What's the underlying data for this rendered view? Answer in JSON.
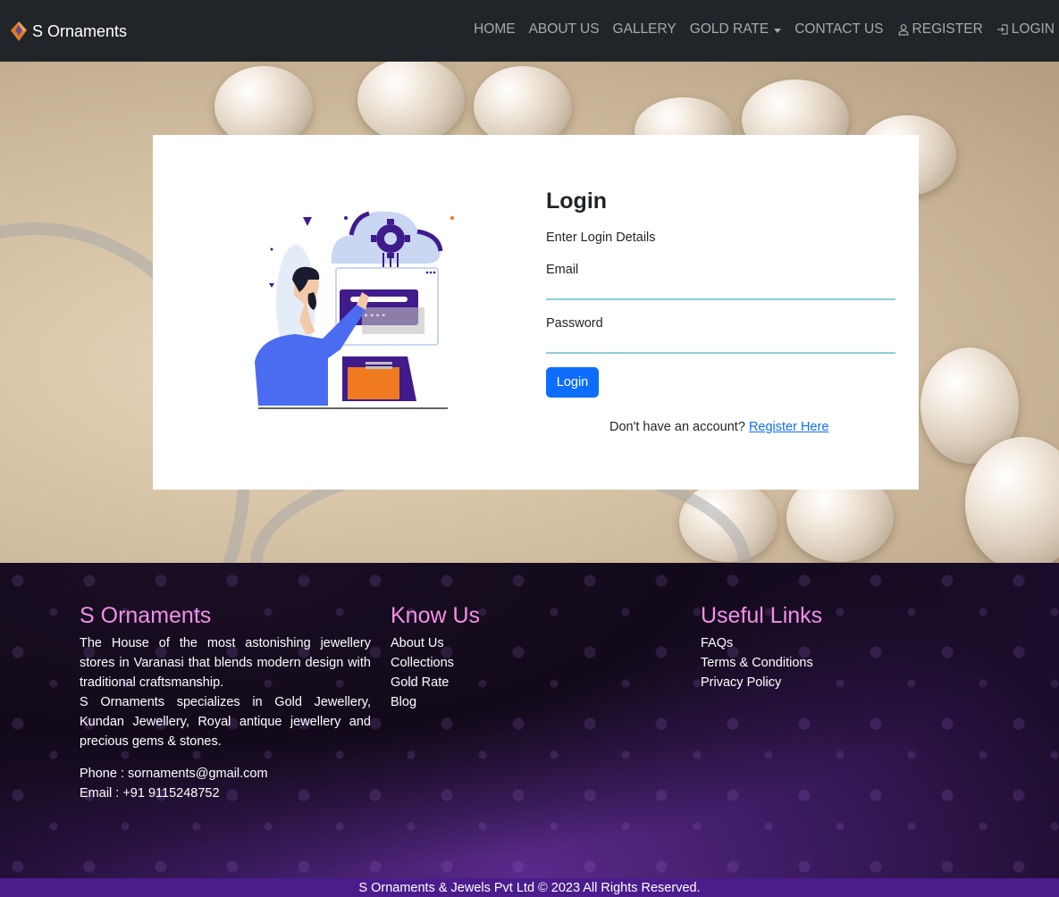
{
  "brand": {
    "name": "S Ornaments",
    "logo_icon": "diamond-logo-icon"
  },
  "nav": {
    "home": "HOME",
    "about": "ABOUT US",
    "gallery": "GALLERY",
    "gold_rate": "GOLD RATE",
    "contact": "CONTACT US",
    "register": "REGISTER",
    "login": "LOGIN"
  },
  "login": {
    "title": "Login",
    "subtitle": "Enter Login Details",
    "email_label": "Email",
    "email_value": "",
    "password_label": "Password",
    "password_value": "",
    "button": "Login",
    "no_account": "Don't have an account?",
    "register_link": "Register Here"
  },
  "footer": {
    "col1": {
      "title": "S Ornaments",
      "about1": "The House of the most astonishing jewellery stores in Varanasi that blends modern design with traditional craftsmanship.",
      "about2": "S Ornaments specializes in Gold Jewellery, Kundan Jewellery, Royal antique jewellery and precious gems & stones.",
      "phone": "Phone : sornaments@gmail.com",
      "email": "Email : +91 9115248752"
    },
    "col2": {
      "title": "Know Us",
      "links": [
        "About Us",
        "Collections",
        "Gold Rate",
        "Blog"
      ]
    },
    "col3": {
      "title": "Useful Links",
      "links": [
        "FAQs",
        "Terms & Conditions",
        "Privacy Policy"
      ]
    },
    "copyright": "S Ornaments & Jewels Pvt Ltd © 2023 All Rights Reserved."
  },
  "colors": {
    "navbar_bg": "#212529",
    "primary_button": "#0d6efd",
    "footer_heading": "#f68ee8",
    "copyright_bar": "#4a1c8c"
  }
}
